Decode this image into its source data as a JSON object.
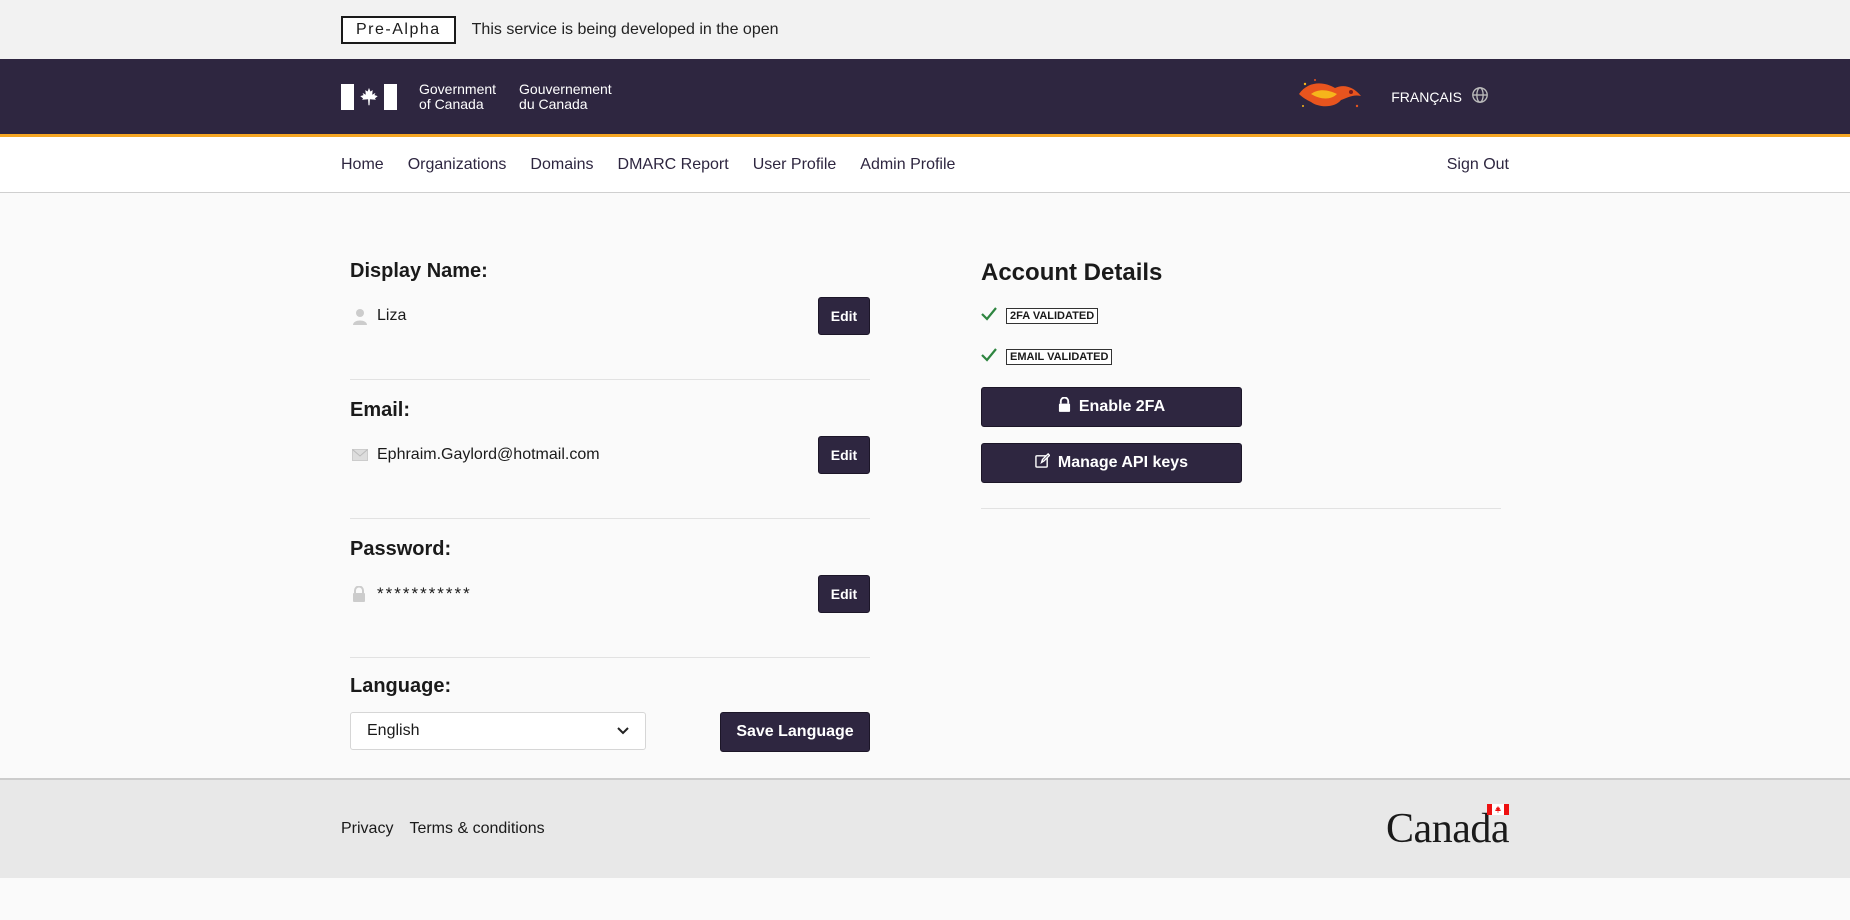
{
  "banner": {
    "phase_tag": "Pre-Alpha",
    "phase_text": "This service is being developed in the open"
  },
  "header": {
    "goc_en_line1": "Government",
    "goc_en_line2": "of Canada",
    "goc_fr_line1": "Gouvernement",
    "goc_fr_line2": "du Canada",
    "language_toggle": "FRANÇAIS",
    "mascot_icon": "phoenix-icon",
    "globe_icon": "globe-icon"
  },
  "nav": {
    "items": [
      "Home",
      "Organizations",
      "Domains",
      "DMARC Report",
      "User Profile",
      "Admin Profile"
    ],
    "sign_out": "Sign Out"
  },
  "profile": {
    "display_name": {
      "label": "Display Name:",
      "value": "Liza",
      "icon": "person-icon",
      "button": "Edit"
    },
    "email": {
      "label": "Email:",
      "value": "Ephraim.Gaylord@hotmail.com",
      "icon": "envelope-icon",
      "button": "Edit"
    },
    "password": {
      "label": "Password:",
      "value": "***********",
      "icon": "lock-icon",
      "button": "Edit"
    },
    "language": {
      "label": "Language:",
      "selected": "English",
      "button": "Save Language"
    }
  },
  "account": {
    "title": "Account Details",
    "badges": [
      "2FA VALIDATED",
      "EMAIL VALIDATED"
    ],
    "enable_2fa": "Enable 2FA",
    "manage_api": "Manage API keys"
  },
  "footer": {
    "privacy": "Privacy",
    "terms": "Terms & conditions",
    "wordmark": "Canada"
  },
  "colors": {
    "brand_dark": "#2e2640",
    "accent_yellow": "#f5a623",
    "check_green": "#2e8540"
  }
}
